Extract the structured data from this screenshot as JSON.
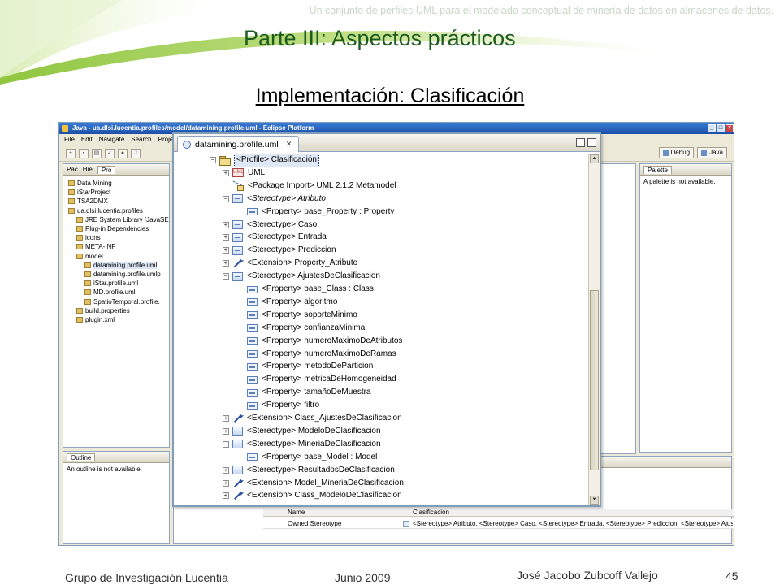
{
  "header": {
    "note": "Un conjunto de perfiles UML para el modelado conceptual de minería de datos en almacenes de datos.",
    "title": "Parte III: Aspectos prácticos",
    "subtitle": "Implementación: Clasificación"
  },
  "footer": {
    "group": "Grupo de Investigación Lucentia",
    "date": "Junio 2009",
    "author": "José Jacobo Zubcoff Vallejo",
    "page": "45"
  },
  "eclipse": {
    "window_title": "Java - ua.dlsi.lucentia.profiles/model/datamining.profile.uml - Eclipse Platform",
    "menu": [
      "File",
      "Edit",
      "Navigate",
      "Search",
      "Project"
    ],
    "perspectives": [
      "Debug",
      "Java"
    ],
    "package_tabs": [
      "Pac",
      "Hie",
      "Pro"
    ],
    "package_tree": [
      "Data Mining",
      "iStarProject",
      "TSA2DMX",
      "ua.dlsi.lucentia.profiles",
      "JRE System Library [JavaSE",
      "Plug-in Dependencies",
      "icons",
      "META-INF",
      "model",
      "datamining.profile.uml",
      "datamining.profile.umlp",
      "iStar.profile.uml",
      "MD.profile.uml",
      "SpatioTemporal.profile.",
      "build.properties",
      "plugin.xml"
    ],
    "outline": {
      "tab": "Outline",
      "message": "An outline is not available."
    },
    "palette": {
      "tab": "Palette",
      "message": "A palette is not available."
    },
    "properties": {
      "col_name": "Name",
      "col_value": "Clasificación",
      "row_name": "Owned Stereotype",
      "row_value": "<Stereotype> Atributo, <Stereotype> Caso, <Stereotype> Entrada, <Stereotype> Prediccion, <Stereotype> Ajuste..."
    }
  },
  "editor": {
    "tab_label": "datamining.profile.uml",
    "tree": [
      {
        "label": "<Profile> Clasificación",
        "indent": 0,
        "icon": "package-icon",
        "exp": "−",
        "selected": true
      },
      {
        "label": "UML",
        "indent": 1,
        "icon": "uml-metaclass-icon",
        "exp": "+"
      },
      {
        "label": "<Package Import> UML 2.1.2 Metamodel",
        "indent": 1,
        "icon": "package-import-icon",
        "exp": ""
      },
      {
        "label": "<Stereotype> Atributo",
        "indent": 1,
        "icon": "stereotype-icon",
        "exp": "−",
        "italic": true
      },
      {
        "label": "<Property> base_Property : Property",
        "indent": 2,
        "icon": "property-icon",
        "exp": ""
      },
      {
        "label": "<Stereotype> Caso",
        "indent": 1,
        "icon": "stereotype-icon",
        "exp": "+"
      },
      {
        "label": "<Stereotype> Entrada",
        "indent": 1,
        "icon": "stereotype-icon",
        "exp": "+"
      },
      {
        "label": "<Stereotype> Prediccion",
        "indent": 1,
        "icon": "stereotype-icon",
        "exp": "+"
      },
      {
        "label": "<Extension> Property_Atributo",
        "indent": 1,
        "icon": "extension-icon",
        "exp": "+"
      },
      {
        "label": "<Stereotype> AjustesDeClasificacion",
        "indent": 1,
        "icon": "stereotype-icon",
        "exp": "−"
      },
      {
        "label": "<Property> base_Class : Class",
        "indent": 2,
        "icon": "property-icon",
        "exp": ""
      },
      {
        "label": "<Property> algoritmo",
        "indent": 2,
        "icon": "property-icon",
        "exp": ""
      },
      {
        "label": "<Property> soporteMinimo",
        "indent": 2,
        "icon": "property-icon",
        "exp": ""
      },
      {
        "label": "<Property> confianzaMinima",
        "indent": 2,
        "icon": "property-icon",
        "exp": ""
      },
      {
        "label": "<Property> numeroMaximoDeAtributos",
        "indent": 2,
        "icon": "property-icon",
        "exp": ""
      },
      {
        "label": "<Property> numeroMaximoDeRamas",
        "indent": 2,
        "icon": "property-icon",
        "exp": ""
      },
      {
        "label": "<Property> metodoDeParticion",
        "indent": 2,
        "icon": "property-icon",
        "exp": ""
      },
      {
        "label": "<Property> metricaDeHomogeneidad",
        "indent": 2,
        "icon": "property-icon",
        "exp": ""
      },
      {
        "label": "<Property> tamañoDeMuestra",
        "indent": 2,
        "icon": "property-icon",
        "exp": ""
      },
      {
        "label": "<Property> filtro",
        "indent": 2,
        "icon": "property-icon",
        "exp": ""
      },
      {
        "label": "<Extension> Class_AjustesDeClasificacion",
        "indent": 1,
        "icon": "extension-icon",
        "exp": "+"
      },
      {
        "label": "<Stereotype> ModeloDeClasificacion",
        "indent": 1,
        "icon": "stereotype-icon",
        "exp": "+"
      },
      {
        "label": "<Stereotype> MineriaDeClasificacion",
        "indent": 1,
        "icon": "stereotype-icon",
        "exp": "−"
      },
      {
        "label": "<Property> base_Model : Model",
        "indent": 2,
        "icon": "property-icon",
        "exp": ""
      },
      {
        "label": "<Stereotype> ResultadosDeClasificacion",
        "indent": 1,
        "icon": "stereotype-icon",
        "exp": "+"
      },
      {
        "label": "<Extension> Model_MineriaDeClasificacion",
        "indent": 1,
        "icon": "extension-icon",
        "exp": "+"
      },
      {
        "label": "<Extension> Class_ModeloDeClasificacion",
        "indent": 1,
        "icon": "extension-icon",
        "exp": "+"
      }
    ]
  }
}
